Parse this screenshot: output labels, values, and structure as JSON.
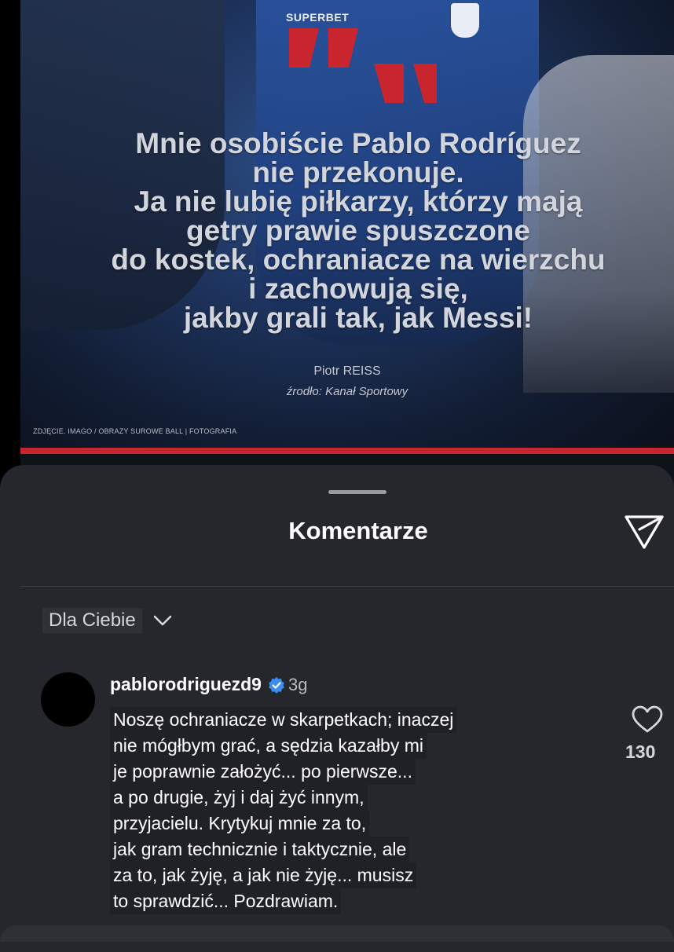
{
  "post": {
    "quote_lines": [
      "Mnie osobiście Pablo Rodríguez",
      "nie przekonuje.",
      "Ja nie lubię piłkarzy, którzy mają",
      "getry prawie spuszczone",
      "do kostek, ochraniacze na wierzchu",
      "i zachowują się,",
      "jakby grali tak, jak Messi!"
    ],
    "author": "Piotr REISS",
    "source": "źrodło: Kanał Sportowy",
    "photo_credit": "ZDJĘCIE. IMAGO / OBRAZY SUROWE BALL |  FOTOGRAFIA",
    "sponsor_text": "SUPERBET",
    "accent_color": "#c8252e"
  },
  "comments_sheet": {
    "title": "Komentarze",
    "filter_label": "Dla Ciebie",
    "comments": [
      {
        "username": "pablorodriguezd9",
        "verified": true,
        "time": "3g",
        "text_lines": [
          "Noszę ochraniacze w skarpetkach; inaczej",
          "nie mógłbym grać, a sędzia kazałby mi",
          "je poprawnie założyć... po pierwsze...",
          "a po drugie, żyj i daj żyć innym,",
          "przyjacielu. Krytykuj mnie za to,",
          "jak gram technicznie i taktycznie, ale",
          "za to, jak żyję, a jak nie żyję... musisz",
          "to sprawdzić... Pozdrawiam."
        ],
        "likes": "130"
      }
    ]
  },
  "icons": {
    "share": "send-triangle-icon",
    "filter_chevron": "chevron-down-icon",
    "like": "heart-icon",
    "verified": "verified-badge-icon",
    "quote": "quote-marks-icon"
  }
}
